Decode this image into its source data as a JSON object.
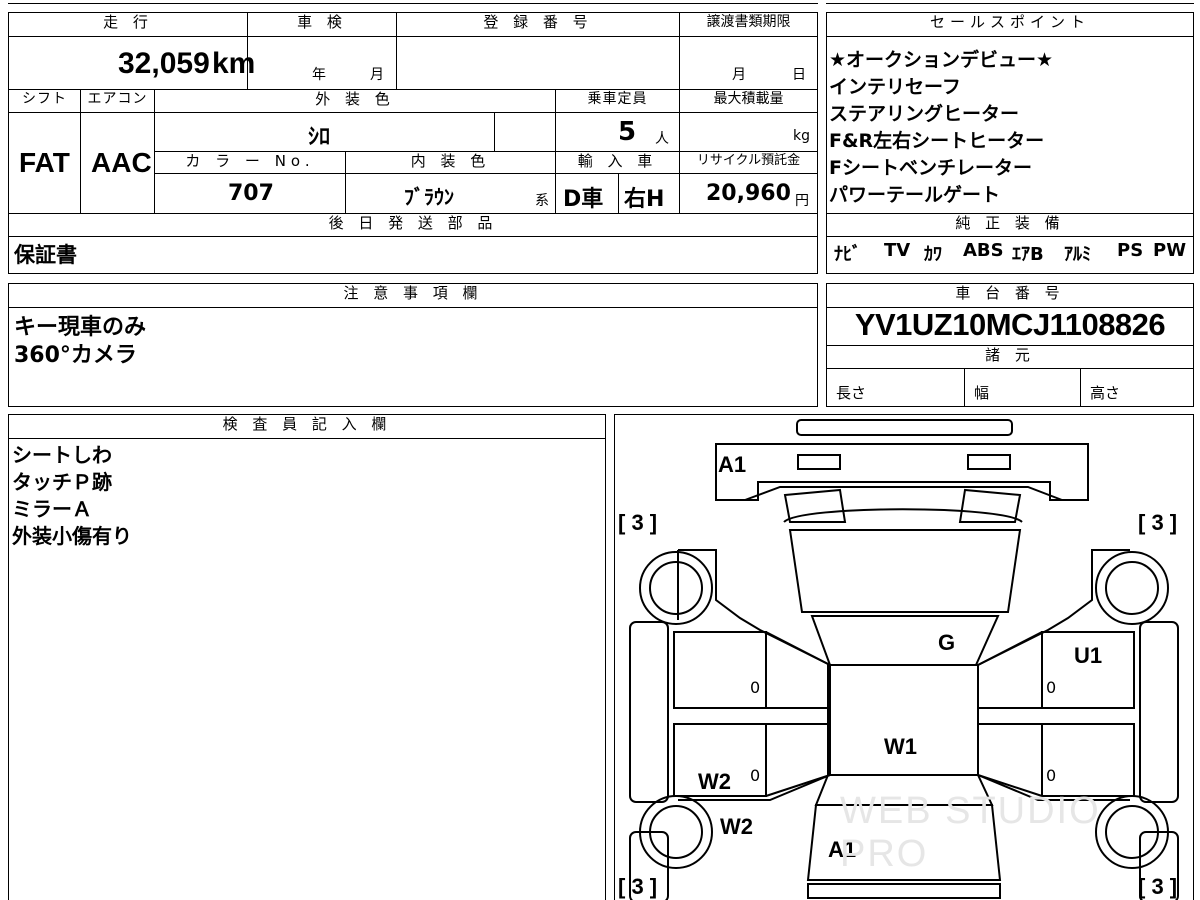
{
  "headers": {
    "mileage": "走 行",
    "shaken": "車 検",
    "registration": "登 録 番 号",
    "transfer_deadline": "譲渡書類期限",
    "sales_points": "セールスポイント",
    "shift": "シフト",
    "aircon": "エアコン",
    "exterior_color": "外 装 色",
    "capacity": "乗車定員",
    "max_load": "最大積載量",
    "color_no": "カ ラ ー No.",
    "interior_color": "内 装 色",
    "import": "輸 入 車",
    "recycle": "リサイクル預託金",
    "later_parts": "後 日 発 送 部 品",
    "genuine_equipment": "純 正 装 備",
    "cautions": "注 意 事 項 欄",
    "chassis_no": "車 台 番 号",
    "specs": "諸 元",
    "inspector": "検 査 員 記 入 欄"
  },
  "vehicle": {
    "mileage": "32,059",
    "mileage_unit": "km",
    "shaken_year": "年",
    "shaken_month": "月",
    "deadline_month": "月",
    "deadline_day": "日",
    "shift": "FAT",
    "aircon": "AAC",
    "exterior_color": "ｼﾛ",
    "capacity": "5",
    "capacity_unit": "人",
    "max_load_unit": "kg",
    "color_no": "707",
    "interior_color": "ﾌﾞﾗｳﾝ",
    "interior_suffix": "系",
    "import_type": "D車",
    "steering": "右H",
    "recycle_fee": "20,960",
    "recycle_unit": "円",
    "chassis_no": "YV1UZ10MCJ1108826",
    "spec_length": "長さ",
    "spec_width": "幅",
    "spec_height": "高さ"
  },
  "sales_points": [
    "★オークションデビュー★",
    "インテリセーフ",
    "ステアリングヒーター",
    "F&R左右シートヒーター",
    "Fシートベンチレーター",
    "パワーテールゲート"
  ],
  "later_parts": "保証書",
  "equipment": [
    "ﾅﾋﾞ",
    "TV",
    "ｶﾜ",
    "ABS",
    "ｴｱB",
    "ｱﾙﾐ",
    "PS",
    "PW"
  ],
  "cautions": [
    "キー現車のみ",
    "360°カメラ"
  ],
  "inspector_notes": [
    "シートしわ",
    "タッチＰ跡",
    "ミラーＡ",
    "外装小傷有り"
  ],
  "diagram": {
    "A1_top": "A1",
    "A1_bottom": "A1",
    "G": "G",
    "U1": "U1",
    "W1": "W1",
    "W2_a": "W2",
    "W2_b": "W2",
    "tire_tl": "[ 3 ]",
    "tire_tr": "[ 3 ]",
    "tire_bl": "[ 3 ]",
    "tire_br": "[ 3 ]",
    "zero": "0",
    "watermark": "WEB STUDIO PRO"
  }
}
